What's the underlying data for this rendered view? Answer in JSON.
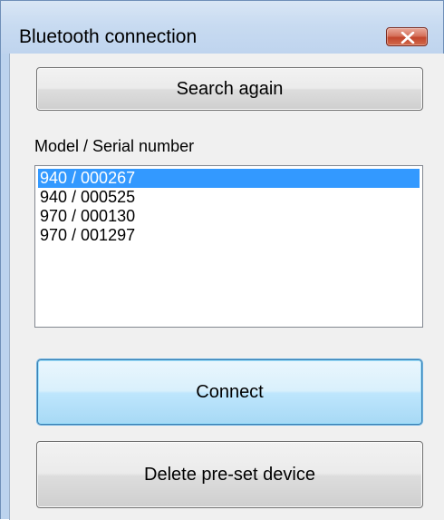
{
  "window": {
    "title": "Bluetooth connection"
  },
  "buttons": {
    "search_again": "Search again",
    "connect": "Connect",
    "delete_preset": "Delete pre-set device"
  },
  "list": {
    "label": "Model / Serial number",
    "items": [
      "940 / 000267",
      "940 / 000525",
      "970 / 000130",
      "970 / 001297"
    ],
    "selected_index": 0
  },
  "colors": {
    "selection": "#3399ff",
    "close_button": "#c2462c",
    "default_button": "#bee6fd"
  },
  "icons": {
    "close": "close-icon"
  }
}
